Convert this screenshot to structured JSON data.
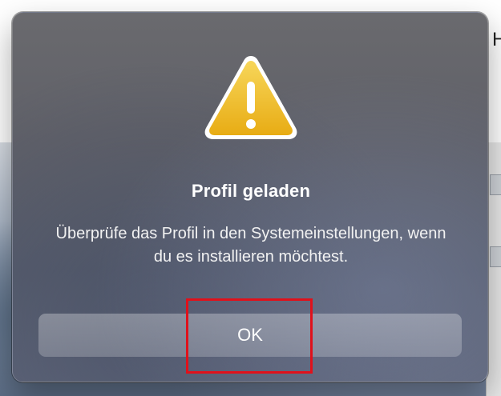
{
  "background": {
    "peek_text": "H"
  },
  "dialog": {
    "icon": "warning-triangle-icon",
    "title": "Profil geladen",
    "message": "Überprüfe das Profil in den Systemeinstellungen, wenn du es installieren möchtest.",
    "ok_label": "OK"
  },
  "annotation": {
    "highlight_color": "#e0111b"
  },
  "colors": {
    "warning_yellow": "#f2c21b",
    "dialog_bg": "#5f6068"
  }
}
